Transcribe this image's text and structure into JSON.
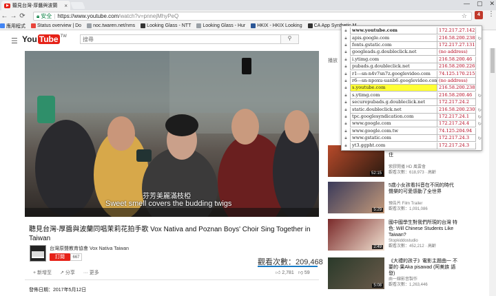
{
  "browser": {
    "tab_title": "聽見台灣-厚醬與波蘭",
    "tab_close": "×",
    "window_controls": [
      "—",
      "▢",
      "✕"
    ],
    "secure_label": "安全",
    "url_host": "https://www.youtube.com",
    "url_path": "/watch?v=pnnejMhyPeQ",
    "extension_badge": "4",
    "bookmarks": [
      {
        "label": "應用程式",
        "color": "#4285f4"
      },
      {
        "label": "Status overview | Do",
        "color": "#e8453c"
      },
      {
        "label": "noc.twaren.net/nms",
        "color": "#9aa0a6"
      },
      {
        "label": "Looking Glass - NTT",
        "color": "#333333"
      },
      {
        "label": "Looking Glass - Hur",
        "color": "#9aa0a6"
      },
      {
        "label": "HKIX - HKIX Looking",
        "color": "#2b5797"
      },
      {
        "label": "CA App Synthetic M",
        "color": "#333333"
      }
    ]
  },
  "youtube": {
    "logo_you": "You",
    "logo_tube": "Tube",
    "logo_region": "TW",
    "search_placeholder": "搜尋",
    "subtitle_zh": "芬芳美麗滿枝椏",
    "subtitle_en": "Sweet smell covers the budding twigs",
    "video_title": "聽見台灣-厚醬與波蘭同唱茉莉花拍手歌 Vox Nativa and Poznan Boys' Choir Sing Together in Taiwan",
    "channel_name": "台灣原聲教育協會 Vox Nativa Taiwan",
    "subscribe_label": "訂閱",
    "subscriber_count": "667",
    "views_label": "觀看次數：",
    "views_count": "209,468",
    "actions": [
      "+ 新增至",
      "↗ 分享",
      "··· 更多"
    ],
    "like_count": "2,781",
    "dislike_count": "59",
    "publish_date": "發佈日期：2017年5月12日",
    "sidebar_label": "播放",
    "related": [
      {
        "title": "到豐原搭車? 實踐：8個豐年不住",
        "meta1": "紫膠開播 HD 風雲會",
        "meta2": "觀看次數：618,973 · 高齡",
        "duration": "52:15"
      },
      {
        "title": "5歲小女孩看抖音在不同的時代 聲樂的可愛感動了全世界",
        "meta1": "預告片 Film Trailer",
        "meta2": "觀看次數：1,091,086",
        "duration": "5:29"
      },
      {
        "title": "國中國學生對我們所現的台灣 特色: Will Chinese Students Like Taiwan?",
        "meta1": "Stopkiddostudio",
        "meta2": "觀看次數：452,212 · 高齡",
        "duration": "2:49"
      },
      {
        "title": "《大禮的孩子》電影主題曲一 不要的·果Aka pisawad (阿美族 語發)",
        "meta1": "由一線影音製作",
        "meta2": "觀看次數：1,263,446",
        "duration": "5:08"
      }
    ]
  },
  "popup": {
    "rows": [
      {
        "domain": "www.youtube.com",
        "ip": "172.217.27.142",
        "bold": true,
        "flag": ""
      },
      {
        "domain": "apis.google.com",
        "ip": "216.58.200.238",
        "bold": false,
        "flag": "↻"
      },
      {
        "domain": "fonts.gstatic.com",
        "ip": "172.217.27.131",
        "bold": false,
        "flag": ""
      },
      {
        "domain": "googleads.g.doubleclick.net",
        "ip": "(no address)",
        "bold": false,
        "flag": ""
      },
      {
        "domain": "i.ytimg.com",
        "ip": "216.58.200.46",
        "bold": false,
        "flag": ""
      },
      {
        "domain": "pubads.g.doubleclick.net",
        "ip": "216.58.200.226",
        "bold": false,
        "flag": ""
      },
      {
        "domain": "r1---sn-n4v7sn7z.googlevideo.com",
        "ip": "74.125.170.215",
        "bold": false,
        "flag": ""
      },
      {
        "domain": "r6---sn-npoxu-uanb6.googlevideo.com",
        "ip": "(no address)",
        "bold": false,
        "flag": ""
      },
      {
        "domain": "s.youtube.com",
        "ip": "216.58.200.238",
        "bold": false,
        "flag": "",
        "highlight": true
      },
      {
        "domain": "s.ytimg.com",
        "ip": "216.58.200.46",
        "bold": false,
        "flag": "↻"
      },
      {
        "domain": "securepubads.g.doubleclick.net",
        "ip": "172.217.24.2",
        "bold": false,
        "flag": ""
      },
      {
        "domain": "static.doubleclick.net",
        "ip": "216.58.200.230",
        "bold": false,
        "flag": "↻"
      },
      {
        "domain": "tpc.googlesyndication.com",
        "ip": "172.217.24.1",
        "bold": false,
        "flag": "↻"
      },
      {
        "domain": "www.google.com",
        "ip": "172.217.24.4",
        "bold": false,
        "flag": "↻"
      },
      {
        "domain": "www.google.com.tw",
        "ip": "74.125.204.94",
        "bold": false,
        "flag": ""
      },
      {
        "domain": "www.gstatic.com",
        "ip": "172.217.24.3",
        "bold": false,
        "flag": "↻"
      },
      {
        "domain": "yt3.ggpht.com",
        "ip": "172.217.24.3",
        "bold": false,
        "flag": ""
      }
    ]
  }
}
